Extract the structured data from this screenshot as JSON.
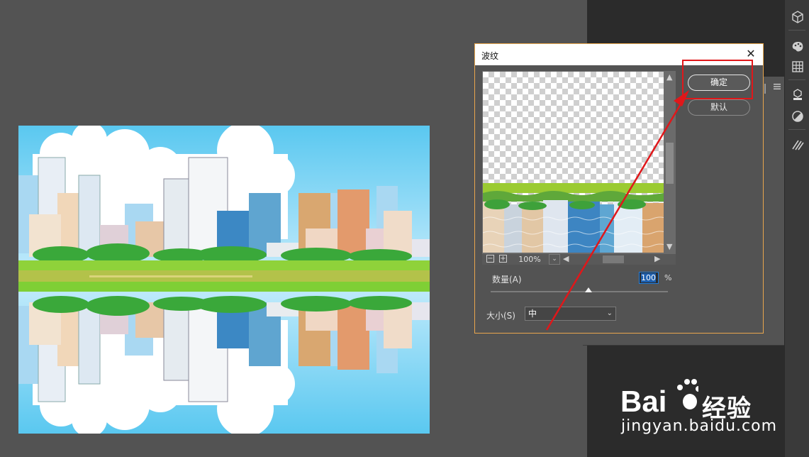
{
  "dialog": {
    "title": "波纹",
    "close_glyph": "✕",
    "ok_label": "确定",
    "default_label": "默认",
    "zoom": {
      "minus_glyph": "−",
      "plus_glyph": "+",
      "value": "100%",
      "dropdown_glyph": "⌄"
    },
    "amount": {
      "label": "数量(A)",
      "value": "100",
      "unit": "%",
      "slider_fraction": 0.55
    },
    "size": {
      "label": "大小(S)",
      "selected": "中",
      "chevron_glyph": "⌄"
    }
  },
  "icons": {
    "dialog_close": "close-icon",
    "scroll_up": "triangle-up-icon",
    "scroll_down": "triangle-down-icon",
    "scroll_left": "triangle-left-icon",
    "scroll_right": "triangle-right-icon",
    "panel_menu": "hamburger-menu-icon",
    "tools": [
      "3d-cube-icon",
      "palette-icon",
      "grid-icon",
      "3d-layers-icon",
      "adjustment-circle-icon",
      "brush-strokes-icon"
    ]
  },
  "colors": {
    "workspace": "#535353",
    "dialog_border": "#e9a64d",
    "highlight": "#e0171a",
    "input_focus": "#1f7ee0"
  },
  "watermark": {
    "brand": "经验",
    "url": "jingyan.baidu.com"
  }
}
